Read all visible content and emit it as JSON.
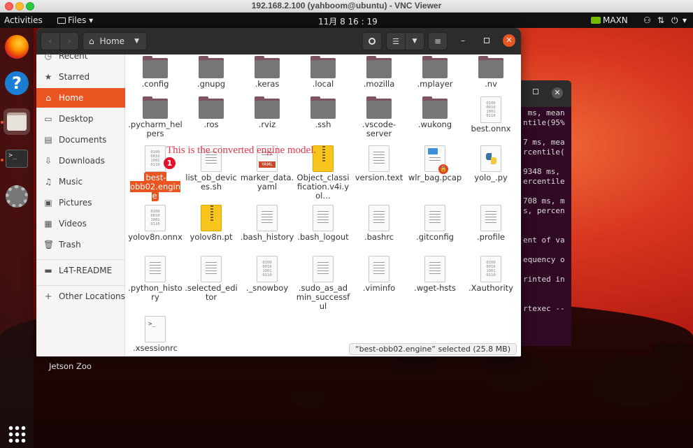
{
  "vnc": {
    "title": "192.168.2.100 (yahboom@ubuntu) - VNC Viewer"
  },
  "topbar": {
    "activities": "Activities",
    "app_menu": "Files",
    "clock": "11月 8 16 : 19",
    "power_mode": "MAXN"
  },
  "dock": {
    "apps": [
      "firefox-icon",
      "help-icon",
      "files-icon",
      "terminal-icon",
      "settings-icon"
    ],
    "show_apps": "show-applications-icon"
  },
  "desktop": {
    "jetson_zoo_label": "Jetson Zoo"
  },
  "files": {
    "location": "Home",
    "sidebar": [
      {
        "label": "Recent",
        "icon": "clock-icon"
      },
      {
        "label": "Starred",
        "icon": "star-icon"
      },
      {
        "label": "Home",
        "icon": "home-icon",
        "active": true
      },
      {
        "label": "Desktop",
        "icon": "desktop-icon"
      },
      {
        "label": "Documents",
        "icon": "document-icon"
      },
      {
        "label": "Downloads",
        "icon": "download-icon"
      },
      {
        "label": "Music",
        "icon": "music-icon"
      },
      {
        "label": "Pictures",
        "icon": "picture-icon"
      },
      {
        "label": "Videos",
        "icon": "video-icon"
      },
      {
        "label": "Trash",
        "icon": "trash-icon"
      },
      {
        "label": "L4T-README",
        "icon": "drive-icon"
      },
      {
        "label": "Other Locations",
        "icon": "plus-icon"
      }
    ],
    "items": [
      {
        "label": ".config",
        "type": "folder"
      },
      {
        "label": ".gnupg",
        "type": "folder"
      },
      {
        "label": ".keras",
        "type": "folder"
      },
      {
        "label": ".local",
        "type": "folder"
      },
      {
        "label": ".mozilla",
        "type": "folder"
      },
      {
        "label": ".mplayer",
        "type": "folder"
      },
      {
        "label": ".nv",
        "type": "folder"
      },
      {
        "label": ".pycharm_helpers",
        "type": "folder"
      },
      {
        "label": ".ros",
        "type": "folder"
      },
      {
        "label": ".rviz",
        "type": "folder"
      },
      {
        "label": ".ssh",
        "type": "folder"
      },
      {
        "label": ".vscode-server",
        "type": "folder"
      },
      {
        "label": ".wukong",
        "type": "folder"
      },
      {
        "label": "best.onnx",
        "type": "binary"
      },
      {
        "label": "best-obb02.engine",
        "type": "binary",
        "selected": true
      },
      {
        "label": "list_ob_devices.sh",
        "type": "text"
      },
      {
        "label": "marker_data.yaml",
        "type": "yaml"
      },
      {
        "label": "Object_classification.v4i.yol…",
        "type": "zip"
      },
      {
        "label": "version.text",
        "type": "text"
      },
      {
        "label": "wlr_bag.pcap",
        "type": "pcap"
      },
      {
        "label": "yolo_.py",
        "type": "python"
      },
      {
        "label": "yolov8n.onnx",
        "type": "binary"
      },
      {
        "label": "yolov8n.pt",
        "type": "zip"
      },
      {
        "label": ".bash_history",
        "type": "text"
      },
      {
        "label": ".bash_logout",
        "type": "text"
      },
      {
        "label": ".bashrc",
        "type": "text"
      },
      {
        "label": ".gitconfig",
        "type": "text"
      },
      {
        "label": ".profile",
        "type": "text"
      },
      {
        "label": ".python_history",
        "type": "text"
      },
      {
        "label": ".selected_editor",
        "type": "text"
      },
      {
        "label": "._snowboy",
        "type": "binary"
      },
      {
        "label": ".sudo_as_admin_successful",
        "type": "text"
      },
      {
        "label": ".viminfo",
        "type": "text"
      },
      {
        "label": ".wget-hsts",
        "type": "text"
      },
      {
        "label": ".Xauthority",
        "type": "binary"
      },
      {
        "label": ".xsessionrc",
        "type": "script"
      }
    ],
    "status": "“best-obb02.engine” selected  (25.8 MB)"
  },
  "annotation": {
    "text": "This is the converted engine model.",
    "badge": "1"
  },
  "terminal": {
    "lines": [
      " ms, mean",
      "ntile(95%",
      "",
      "7 ms, mea",
      "rcentile(",
      "",
      "9348 ms,",
      "ercentile",
      "",
      "708 ms, m",
      "s, percen",
      "",
      "",
      "ent of va",
      "",
      "equency o",
      "",
      "rinted in",
      "",
      "",
      "rtexec --"
    ]
  },
  "colors": {
    "accent": "#e95420",
    "annotation": "#e8364b",
    "folder": "#767676",
    "terminal_bg": "#300a24"
  }
}
